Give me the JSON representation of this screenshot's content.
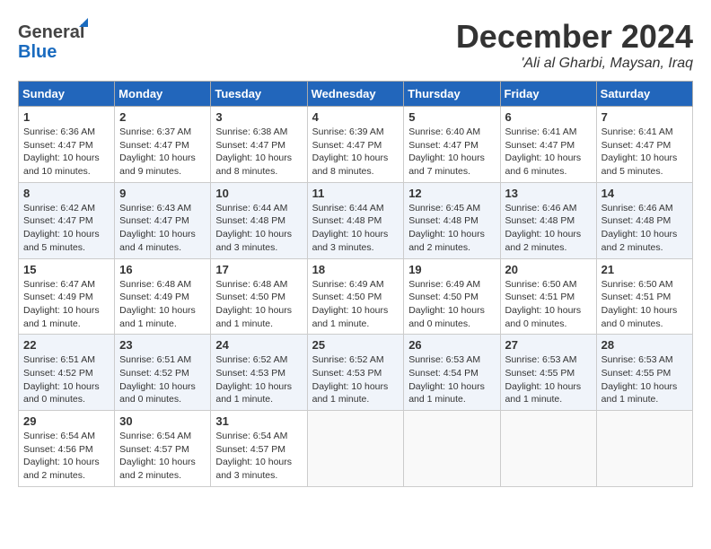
{
  "logo": {
    "line1": "General",
    "line2": "Blue"
  },
  "title": "December 2024",
  "subtitle": "'Ali al Gharbi, Maysan, Iraq",
  "days_of_week": [
    "Sunday",
    "Monday",
    "Tuesday",
    "Wednesday",
    "Thursday",
    "Friday",
    "Saturday"
  ],
  "weeks": [
    [
      {
        "day": 1,
        "info": "Sunrise: 6:36 AM\nSunset: 4:47 PM\nDaylight: 10 hours\nand 10 minutes."
      },
      {
        "day": 2,
        "info": "Sunrise: 6:37 AM\nSunset: 4:47 PM\nDaylight: 10 hours\nand 9 minutes."
      },
      {
        "day": 3,
        "info": "Sunrise: 6:38 AM\nSunset: 4:47 PM\nDaylight: 10 hours\nand 8 minutes."
      },
      {
        "day": 4,
        "info": "Sunrise: 6:39 AM\nSunset: 4:47 PM\nDaylight: 10 hours\nand 8 minutes."
      },
      {
        "day": 5,
        "info": "Sunrise: 6:40 AM\nSunset: 4:47 PM\nDaylight: 10 hours\nand 7 minutes."
      },
      {
        "day": 6,
        "info": "Sunrise: 6:41 AM\nSunset: 4:47 PM\nDaylight: 10 hours\nand 6 minutes."
      },
      {
        "day": 7,
        "info": "Sunrise: 6:41 AM\nSunset: 4:47 PM\nDaylight: 10 hours\nand 5 minutes."
      }
    ],
    [
      {
        "day": 8,
        "info": "Sunrise: 6:42 AM\nSunset: 4:47 PM\nDaylight: 10 hours\nand 5 minutes."
      },
      {
        "day": 9,
        "info": "Sunrise: 6:43 AM\nSunset: 4:47 PM\nDaylight: 10 hours\nand 4 minutes."
      },
      {
        "day": 10,
        "info": "Sunrise: 6:44 AM\nSunset: 4:48 PM\nDaylight: 10 hours\nand 3 minutes."
      },
      {
        "day": 11,
        "info": "Sunrise: 6:44 AM\nSunset: 4:48 PM\nDaylight: 10 hours\nand 3 minutes."
      },
      {
        "day": 12,
        "info": "Sunrise: 6:45 AM\nSunset: 4:48 PM\nDaylight: 10 hours\nand 2 minutes."
      },
      {
        "day": 13,
        "info": "Sunrise: 6:46 AM\nSunset: 4:48 PM\nDaylight: 10 hours\nand 2 minutes."
      },
      {
        "day": 14,
        "info": "Sunrise: 6:46 AM\nSunset: 4:48 PM\nDaylight: 10 hours\nand 2 minutes."
      }
    ],
    [
      {
        "day": 15,
        "info": "Sunrise: 6:47 AM\nSunset: 4:49 PM\nDaylight: 10 hours\nand 1 minute."
      },
      {
        "day": 16,
        "info": "Sunrise: 6:48 AM\nSunset: 4:49 PM\nDaylight: 10 hours\nand 1 minute."
      },
      {
        "day": 17,
        "info": "Sunrise: 6:48 AM\nSunset: 4:50 PM\nDaylight: 10 hours\nand 1 minute."
      },
      {
        "day": 18,
        "info": "Sunrise: 6:49 AM\nSunset: 4:50 PM\nDaylight: 10 hours\nand 1 minute."
      },
      {
        "day": 19,
        "info": "Sunrise: 6:49 AM\nSunset: 4:50 PM\nDaylight: 10 hours\nand 0 minutes."
      },
      {
        "day": 20,
        "info": "Sunrise: 6:50 AM\nSunset: 4:51 PM\nDaylight: 10 hours\nand 0 minutes."
      },
      {
        "day": 21,
        "info": "Sunrise: 6:50 AM\nSunset: 4:51 PM\nDaylight: 10 hours\nand 0 minutes."
      }
    ],
    [
      {
        "day": 22,
        "info": "Sunrise: 6:51 AM\nSunset: 4:52 PM\nDaylight: 10 hours\nand 0 minutes."
      },
      {
        "day": 23,
        "info": "Sunrise: 6:51 AM\nSunset: 4:52 PM\nDaylight: 10 hours\nand 0 minutes."
      },
      {
        "day": 24,
        "info": "Sunrise: 6:52 AM\nSunset: 4:53 PM\nDaylight: 10 hours\nand 1 minute."
      },
      {
        "day": 25,
        "info": "Sunrise: 6:52 AM\nSunset: 4:53 PM\nDaylight: 10 hours\nand 1 minute."
      },
      {
        "day": 26,
        "info": "Sunrise: 6:53 AM\nSunset: 4:54 PM\nDaylight: 10 hours\nand 1 minute."
      },
      {
        "day": 27,
        "info": "Sunrise: 6:53 AM\nSunset: 4:55 PM\nDaylight: 10 hours\nand 1 minute."
      },
      {
        "day": 28,
        "info": "Sunrise: 6:53 AM\nSunset: 4:55 PM\nDaylight: 10 hours\nand 1 minute."
      }
    ],
    [
      {
        "day": 29,
        "info": "Sunrise: 6:54 AM\nSunset: 4:56 PM\nDaylight: 10 hours\nand 2 minutes."
      },
      {
        "day": 30,
        "info": "Sunrise: 6:54 AM\nSunset: 4:57 PM\nDaylight: 10 hours\nand 2 minutes."
      },
      {
        "day": 31,
        "info": "Sunrise: 6:54 AM\nSunset: 4:57 PM\nDaylight: 10 hours\nand 3 minutes."
      },
      null,
      null,
      null,
      null
    ]
  ]
}
